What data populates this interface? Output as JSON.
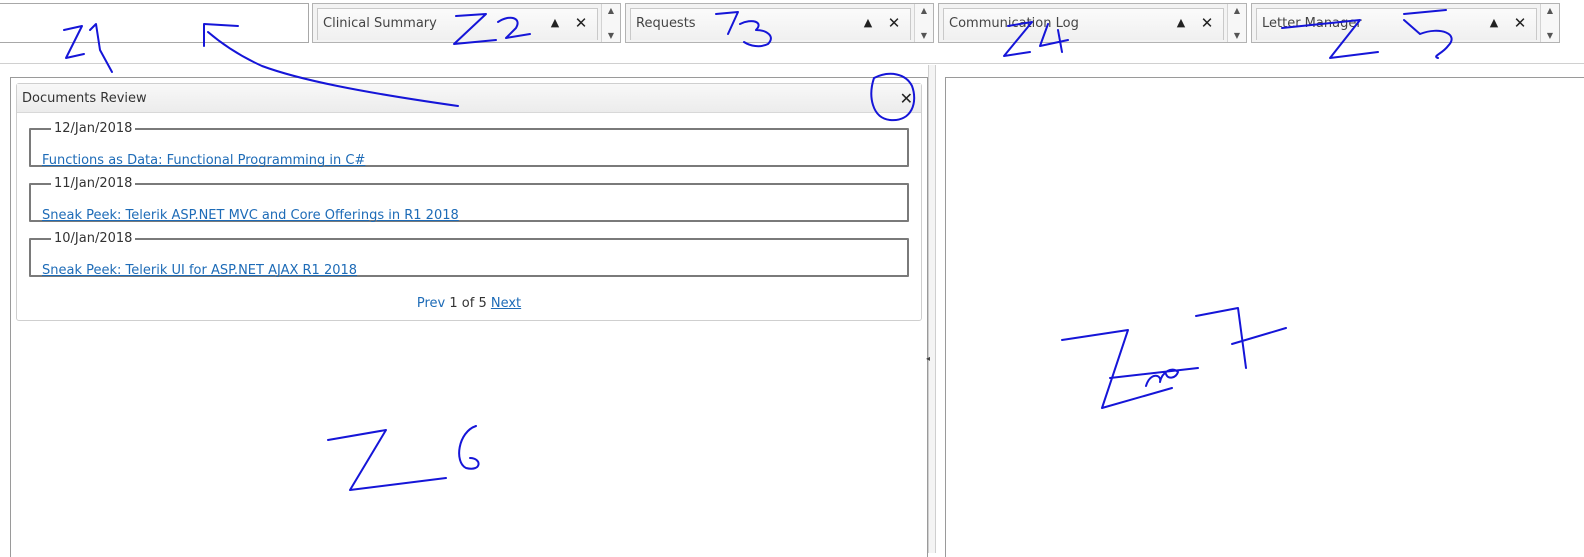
{
  "zones": [
    {
      "title": "Clinical Summary"
    },
    {
      "title": "Requests"
    },
    {
      "title": "Communication Log"
    },
    {
      "title": "Letter Manager"
    }
  ],
  "zone_buttons": {
    "collapse": "▲",
    "close": "✕",
    "scroll_up": "▲",
    "scroll_down": "▼"
  },
  "widget": {
    "title": "Documents Review",
    "close": "✕",
    "documents": [
      {
        "date": "12/Jan/2018",
        "link": "Functions as Data: Functional Programming in C#"
      },
      {
        "date": "11/Jan/2018",
        "link": "Sneak Peek: Telerik ASP.NET MVC and Core Offerings in R1 2018"
      },
      {
        "date": "10/Jan/2018",
        "link": "Sneak Peek: Telerik UI for ASP.NET AJAX R1 2018"
      }
    ],
    "pager": {
      "prev": "Prev",
      "current": "1",
      "of_label": "of",
      "total": "5",
      "next": "Next"
    }
  },
  "splitter_arrow": "◂",
  "annotation_color": "#1515d8",
  "colors": {
    "link": "#1d6bb7"
  }
}
